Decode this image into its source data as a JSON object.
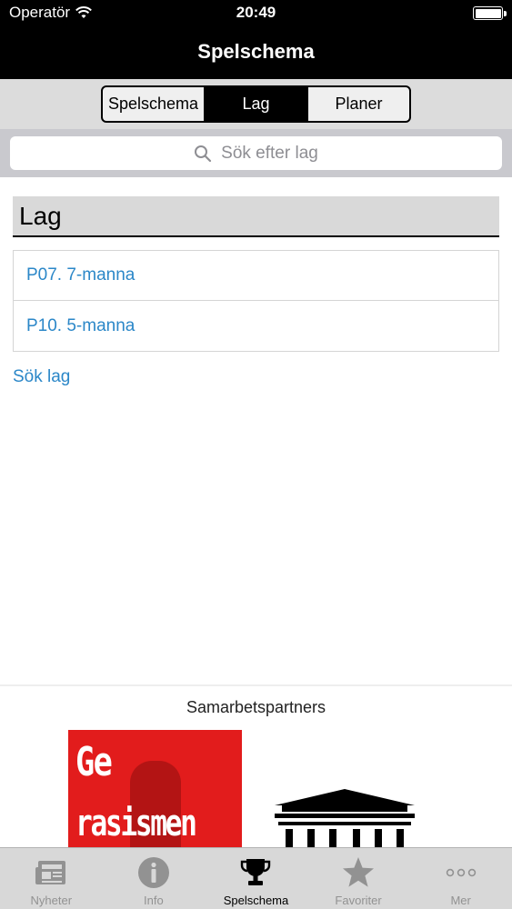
{
  "status_bar": {
    "carrier": "Operatör",
    "time": "20:49"
  },
  "nav": {
    "title": "Spelschema"
  },
  "segments": [
    {
      "label": "Spelschema",
      "active": false
    },
    {
      "label": "Lag",
      "active": true
    },
    {
      "label": "Planer",
      "active": false
    }
  ],
  "search": {
    "placeholder": "Sök efter lag"
  },
  "section": {
    "title": "Lag"
  },
  "teams": [
    {
      "label": "P07. 7-manna"
    },
    {
      "label": "P10. 5-manna"
    }
  ],
  "search_link": "Sök lag",
  "partners": {
    "title": "Samarbetspartners",
    "logo_ge_line1": "Ge",
    "logo_ge_line2": "rasismen"
  },
  "tabs": [
    {
      "label": "Nyheter",
      "icon": "newspaper-icon",
      "active": false
    },
    {
      "label": "Info",
      "icon": "info-icon",
      "active": false
    },
    {
      "label": "Spelschema",
      "icon": "trophy-icon",
      "active": true
    },
    {
      "label": "Favoriter",
      "icon": "star-icon",
      "active": false
    },
    {
      "label": "Mer",
      "icon": "more-icon",
      "active": false
    }
  ],
  "colors": {
    "link": "#2b87c8",
    "nav_bg": "#000000",
    "tab_inactive": "#929292",
    "logo_red": "#e21c1c"
  }
}
